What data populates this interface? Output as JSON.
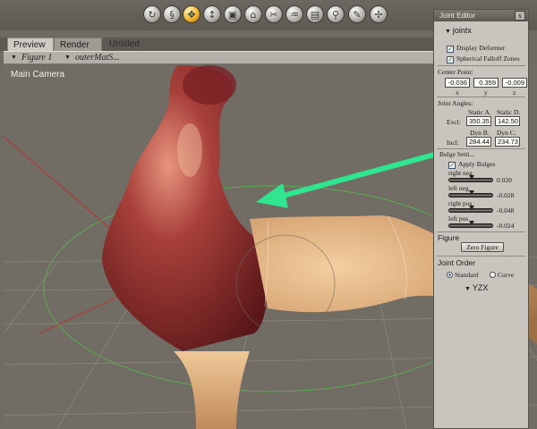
{
  "viewport": {
    "camera_label": "Main Camera"
  },
  "tabs": {
    "preview": "Preview",
    "render": "Render",
    "untitled": "Untitled"
  },
  "docbar": {
    "figure": "Figure 1",
    "material": "outerMatS..."
  },
  "toolbar": {
    "tools": [
      "rotate-icon",
      "twist-icon",
      "translate-icon",
      "translate-in-out-icon",
      "scale-icon",
      "taper-icon",
      "chain-break-icon",
      "color-icon",
      "grouping-icon",
      "view-magnifier-icon",
      "morph-brush-icon",
      "direct-manipulation-icon"
    ],
    "active_tool": "translate-icon",
    "accent": "#f2b52a"
  },
  "joint_editor": {
    "title": "Joint Editor",
    "close": "x",
    "joint_name": "jointx",
    "display_deformer": "Display Deformer",
    "spherical_falloff": "Spherical Falloff Zones",
    "center_point": {
      "label": "Center Point:",
      "x": "-0.036",
      "y": "0.359",
      "z": "-0.009",
      "x_label": "x",
      "y_label": "y",
      "z_label": "z"
    },
    "joint_angles": {
      "label": "Joint Angles:",
      "static_a_label": "Static A.",
      "static_d_label": "Static D.",
      "excl_label": "Excl:",
      "excl_a": "350.35",
      "excl_d": "142.50",
      "dyn_b_label": "Dyn B.",
      "dyn_c_label": "Dyn C.",
      "incl_label": "Incl:",
      "incl_b": "284.44",
      "incl_c": "234.73"
    },
    "bulge": {
      "label": "Bulge Setti...",
      "apply": "Apply Bulges",
      "items": [
        {
          "label": "right neg",
          "value": "0.020"
        },
        {
          "label": "left neg",
          "value": "-0.028"
        },
        {
          "label": "right pos",
          "value": "-0.048"
        },
        {
          "label": "left pos",
          "value": "-0.024"
        }
      ]
    },
    "figure": {
      "label": "Figure",
      "zero_button": "Zero Figure"
    },
    "joint_order": {
      "label": "Joint Order",
      "standard": "Standard",
      "curve": "Curve",
      "order_value": "YZX"
    }
  }
}
